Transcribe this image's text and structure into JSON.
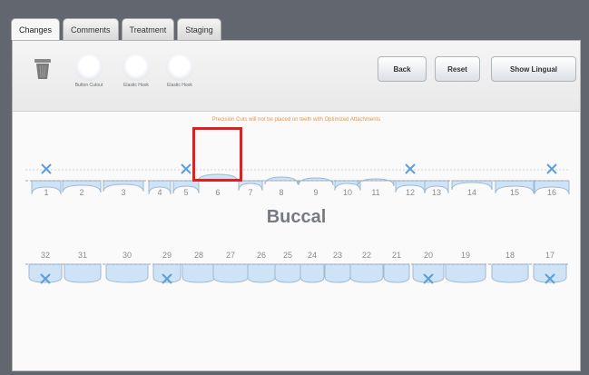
{
  "tabs": [
    {
      "label": "Changes",
      "active": true
    },
    {
      "label": "Comments",
      "active": false
    },
    {
      "label": "Treatment",
      "active": false
    },
    {
      "label": "Staging",
      "active": false
    }
  ],
  "toolbar": {
    "tools": [
      {
        "label": "Button Cutout",
        "icon": "button-cutout-icon"
      },
      {
        "label": "Elastic Hook",
        "icon": "elastic-hook-icon"
      },
      {
        "label": "Elastic Hook",
        "icon": "elastic-hook-icon"
      }
    ],
    "back_label": "Back",
    "reset_label": "Reset",
    "show_lingual_label": "Show Lingual"
  },
  "notice": "Precision Cuts will not be placed on teeth with Optimized Attachments",
  "upper": {
    "numbers": [
      "1",
      "2",
      "3",
      "4",
      "5",
      "6",
      "7",
      "8",
      "9",
      "10",
      "11",
      "12",
      "13",
      "14",
      "15",
      "16"
    ],
    "crossed": [
      "1",
      "5",
      "12",
      "16"
    ]
  },
  "view_label": "Buccal",
  "lower": {
    "numbers": [
      "32",
      "31",
      "30",
      "29",
      "28",
      "27",
      "26",
      "25",
      "24",
      "23",
      "22",
      "21",
      "20",
      "19",
      "18",
      "17"
    ],
    "crossed": [
      "32",
      "29",
      "20",
      "17"
    ]
  },
  "colors": {
    "tooth_fill": "#cfe3f6",
    "tooth_stroke": "#9fb9d2",
    "cross": "#5c9ed8",
    "highlight": "#e01f1f",
    "notice": "#e7954b"
  }
}
